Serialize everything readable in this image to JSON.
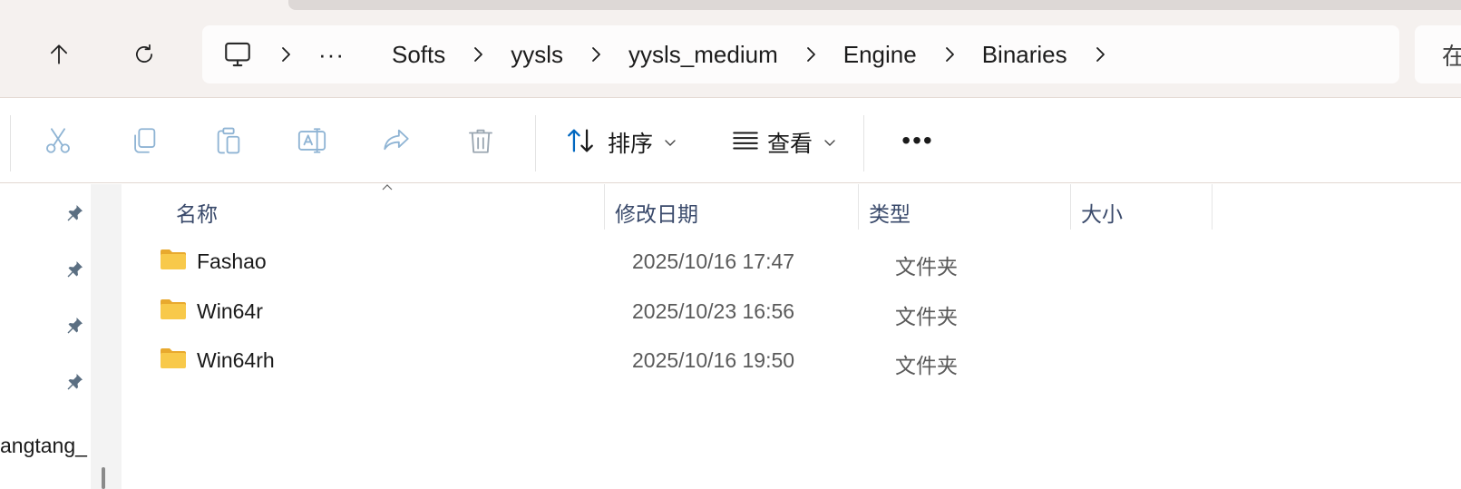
{
  "breadcrumb": {
    "items": [
      "Softs",
      "yysls",
      "yysls_medium",
      "Engine",
      "Binaries"
    ],
    "overflow": "···"
  },
  "search": {
    "placeholder_fragment": "在"
  },
  "toolbar": {
    "sort_label": "排序",
    "view_label": "查看",
    "more_label": "•••",
    "icons": [
      "cut-icon",
      "copy-icon",
      "paste-icon",
      "rename-icon",
      "share-icon",
      "delete-icon"
    ]
  },
  "navpane": {
    "partial_label": "angtang_"
  },
  "columns": {
    "name": "名称",
    "modified": "修改日期",
    "type": "类型",
    "size": "大小"
  },
  "files": [
    {
      "name": "Fashao",
      "modified": "2025/10/16 17:47",
      "type": "文件夹",
      "size": ""
    },
    {
      "name": "Win64r",
      "modified": "2025/10/23 16:56",
      "type": "文件夹",
      "size": ""
    },
    {
      "name": "Win64rh",
      "modified": "2025/10/16 19:50",
      "type": "文件夹",
      "size": ""
    }
  ],
  "colors": {
    "accent": "#0067c0",
    "folder": "#f8c94a",
    "disabled_icon": "#8fb4d4"
  }
}
